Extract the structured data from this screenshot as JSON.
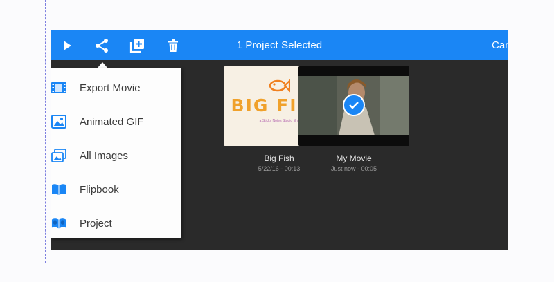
{
  "toolbar": {
    "title": "1 Project Selected",
    "cancel_label": "Can",
    "icons": [
      "play-icon",
      "share-icon",
      "duplicate-icon",
      "trash-icon"
    ],
    "color": "#1a86f5"
  },
  "share_menu": {
    "items": [
      {
        "label": "Export Movie",
        "icon": "film-icon"
      },
      {
        "label": "Animated GIF",
        "icon": "image-icon"
      },
      {
        "label": "All Images",
        "icon": "images-icon"
      },
      {
        "label": "Flipbook",
        "icon": "book-icon"
      },
      {
        "label": "Project",
        "icon": "project-icon"
      }
    ]
  },
  "projects": [
    {
      "title": "Big Fish",
      "meta": "5/22/16 - 00:13",
      "thumb_title": "BIG FISH",
      "thumb_subtitle": "a Sticky Notes Studio film",
      "selected": false
    },
    {
      "title": "My Movie",
      "meta": "Just now - 00:05",
      "selected": true
    }
  ],
  "colors": {
    "background": "#2a2a2a",
    "accent": "#1a86f5",
    "menu": "#fdfdfd"
  }
}
